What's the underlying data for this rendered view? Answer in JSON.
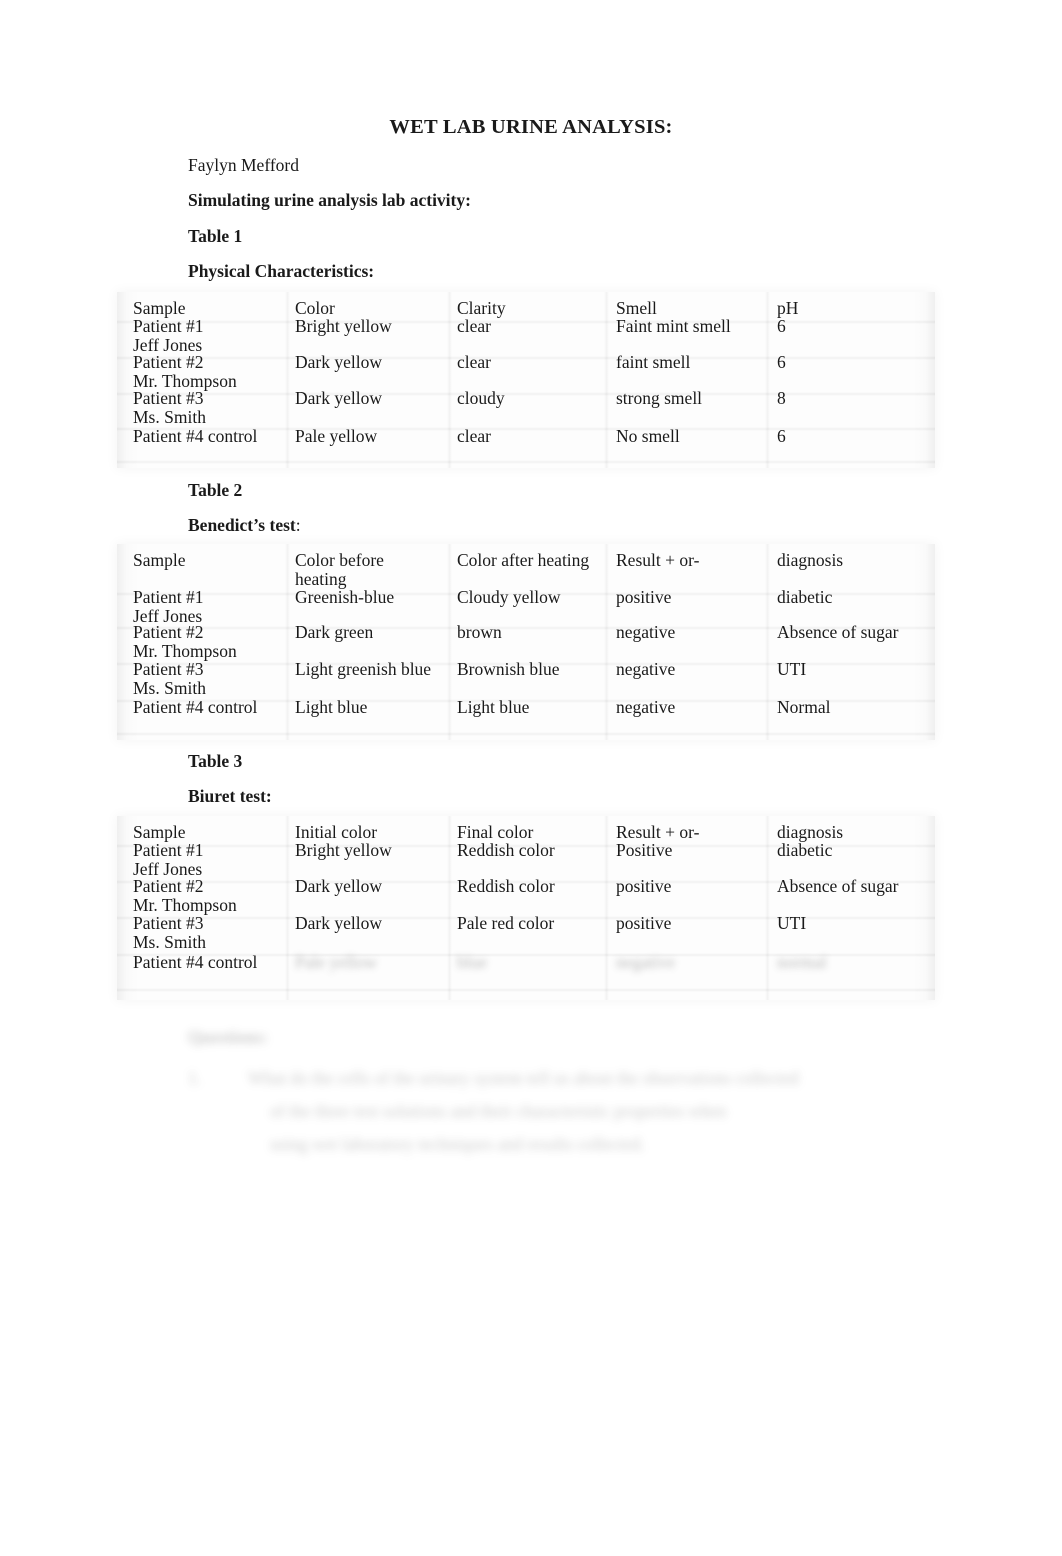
{
  "document": {
    "title": "WET LAB URINE ANALYSIS:",
    "author": "Faylyn Mefford",
    "activity_heading": "Simulating urine analysis lab activity:"
  },
  "table1": {
    "caption": "Table 1",
    "subtitle": "Physical Characteristics:",
    "headers": [
      "Sample",
      "Color",
      "Clarity",
      "Smell",
      "pH"
    ],
    "rows": [
      {
        "sample": "Patient #1\nJeff Jones",
        "color": "Bright yellow",
        "clarity": "clear",
        "smell": "Faint mint smell",
        "ph": "6"
      },
      {
        "sample": "Patient #2\nMr. Thompson",
        "color": "Dark yellow",
        "clarity": "clear",
        "smell": "faint smell",
        "ph": "6"
      },
      {
        "sample": "Patient #3\nMs. Smith",
        "color": "Dark yellow",
        "clarity": "cloudy",
        "smell": "strong smell",
        "ph": "8"
      },
      {
        "sample": "Patient #4 control",
        "color": "Pale yellow",
        "clarity": "clear",
        "smell": "No smell",
        "ph": "6"
      }
    ]
  },
  "table2": {
    "caption": "Table 2",
    "subtitle_bold": "Benedict’s test",
    "subtitle_rest": ":",
    "headers": [
      "Sample",
      "Color before heating",
      "Color after heating",
      "Result + or-",
      "diagnosis"
    ],
    "rows": [
      {
        "sample": "Patient #1\nJeff Jones",
        "before": "Greenish-blue",
        "after": "Cloudy yellow",
        "result": "positive",
        "diagnosis": "diabetic"
      },
      {
        "sample": "Patient #2\nMr. Thompson",
        "before": "Dark green",
        "after": "brown",
        "result": "negative",
        "diagnosis": "Absence of sugar"
      },
      {
        "sample": "Patient #3\nMs. Smith",
        "before": "Light greenish blue",
        "after": "Brownish blue",
        "result": "negative",
        "diagnosis": "UTI"
      },
      {
        "sample": "Patient #4 control",
        "before": "Light blue",
        "after": "Light blue",
        "result": "negative",
        "diagnosis": "Normal"
      }
    ]
  },
  "table3": {
    "caption": "Table 3",
    "subtitle": "Biuret test:",
    "headers": [
      "Sample",
      "Initial color",
      "Final color",
      "Result + or-",
      "diagnosis"
    ],
    "rows": [
      {
        "sample": "Patient #1\nJeff Jones",
        "initial": "Bright yellow",
        "final": "Reddish color",
        "result": "Positive",
        "diagnosis": "diabetic"
      },
      {
        "sample": "Patient #2\nMr. Thompson",
        "initial": "Dark yellow",
        "final": "Reddish color",
        "result": "positive",
        "diagnosis": "Absence of sugar"
      },
      {
        "sample": "Patient #3\nMs. Smith",
        "initial": "Dark yellow",
        "final": "Pale red color",
        "result": "positive",
        "diagnosis": "UTI"
      },
      {
        "sample": "Patient #4 control",
        "initial": "Pale yellow",
        "final": "blue",
        "result": "negative",
        "diagnosis": "normal",
        "blurred": true
      }
    ]
  },
  "questions": {
    "heading": "Questions:",
    "items": [
      {
        "number": "1.",
        "line1": "What do the cells of the urinary system tell us about the observations collected",
        "line2": "of the three test solutions and their characteristic properties when",
        "line3": "using wet laboratory techniques and results collected."
      }
    ]
  },
  "colors": {
    "page_background": "#ffffff",
    "text": "#1a1a1a",
    "table_background": "#fdfdfd",
    "separator": "rgba(0,0,0,0.05)"
  }
}
